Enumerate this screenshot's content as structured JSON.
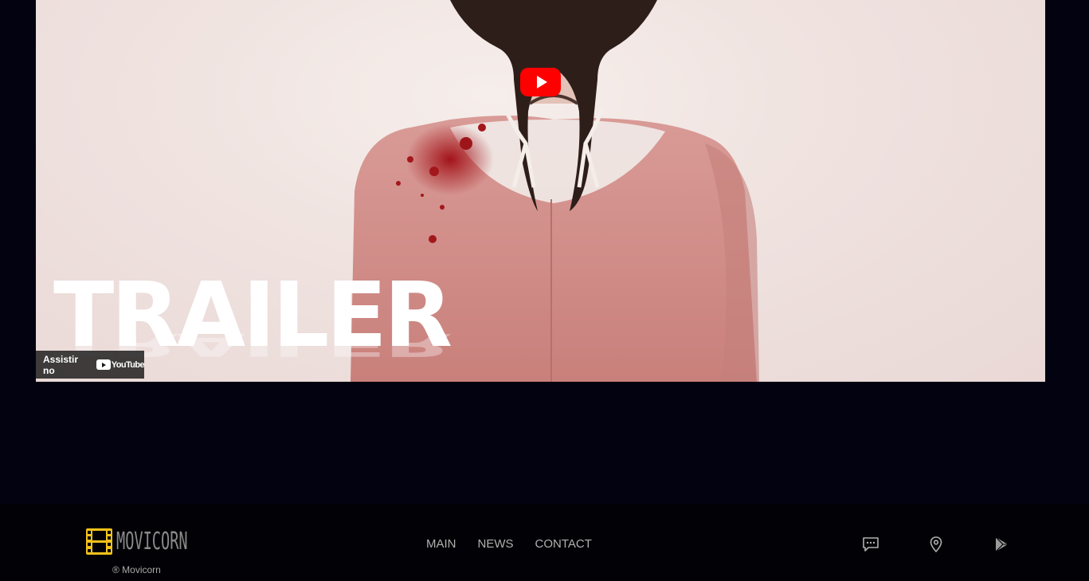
{
  "video": {
    "title_text": "TRAILER",
    "watch_on_label": "Assistir no",
    "youtube_wordmark": "YouTube",
    "play_button_color": "#ff0000"
  },
  "footer": {
    "brand_name": "MOVICORN",
    "brand_icon": "film-strip-icon",
    "brand_icon_color": "#f2c21b",
    "copyright": "® Movicorn",
    "nav": [
      {
        "label": "MAIN"
      },
      {
        "label": "NEWS"
      },
      {
        "label": "CONTACT"
      }
    ],
    "icons": [
      "chat-icon",
      "location-pin-icon",
      "play-store-icon"
    ]
  }
}
